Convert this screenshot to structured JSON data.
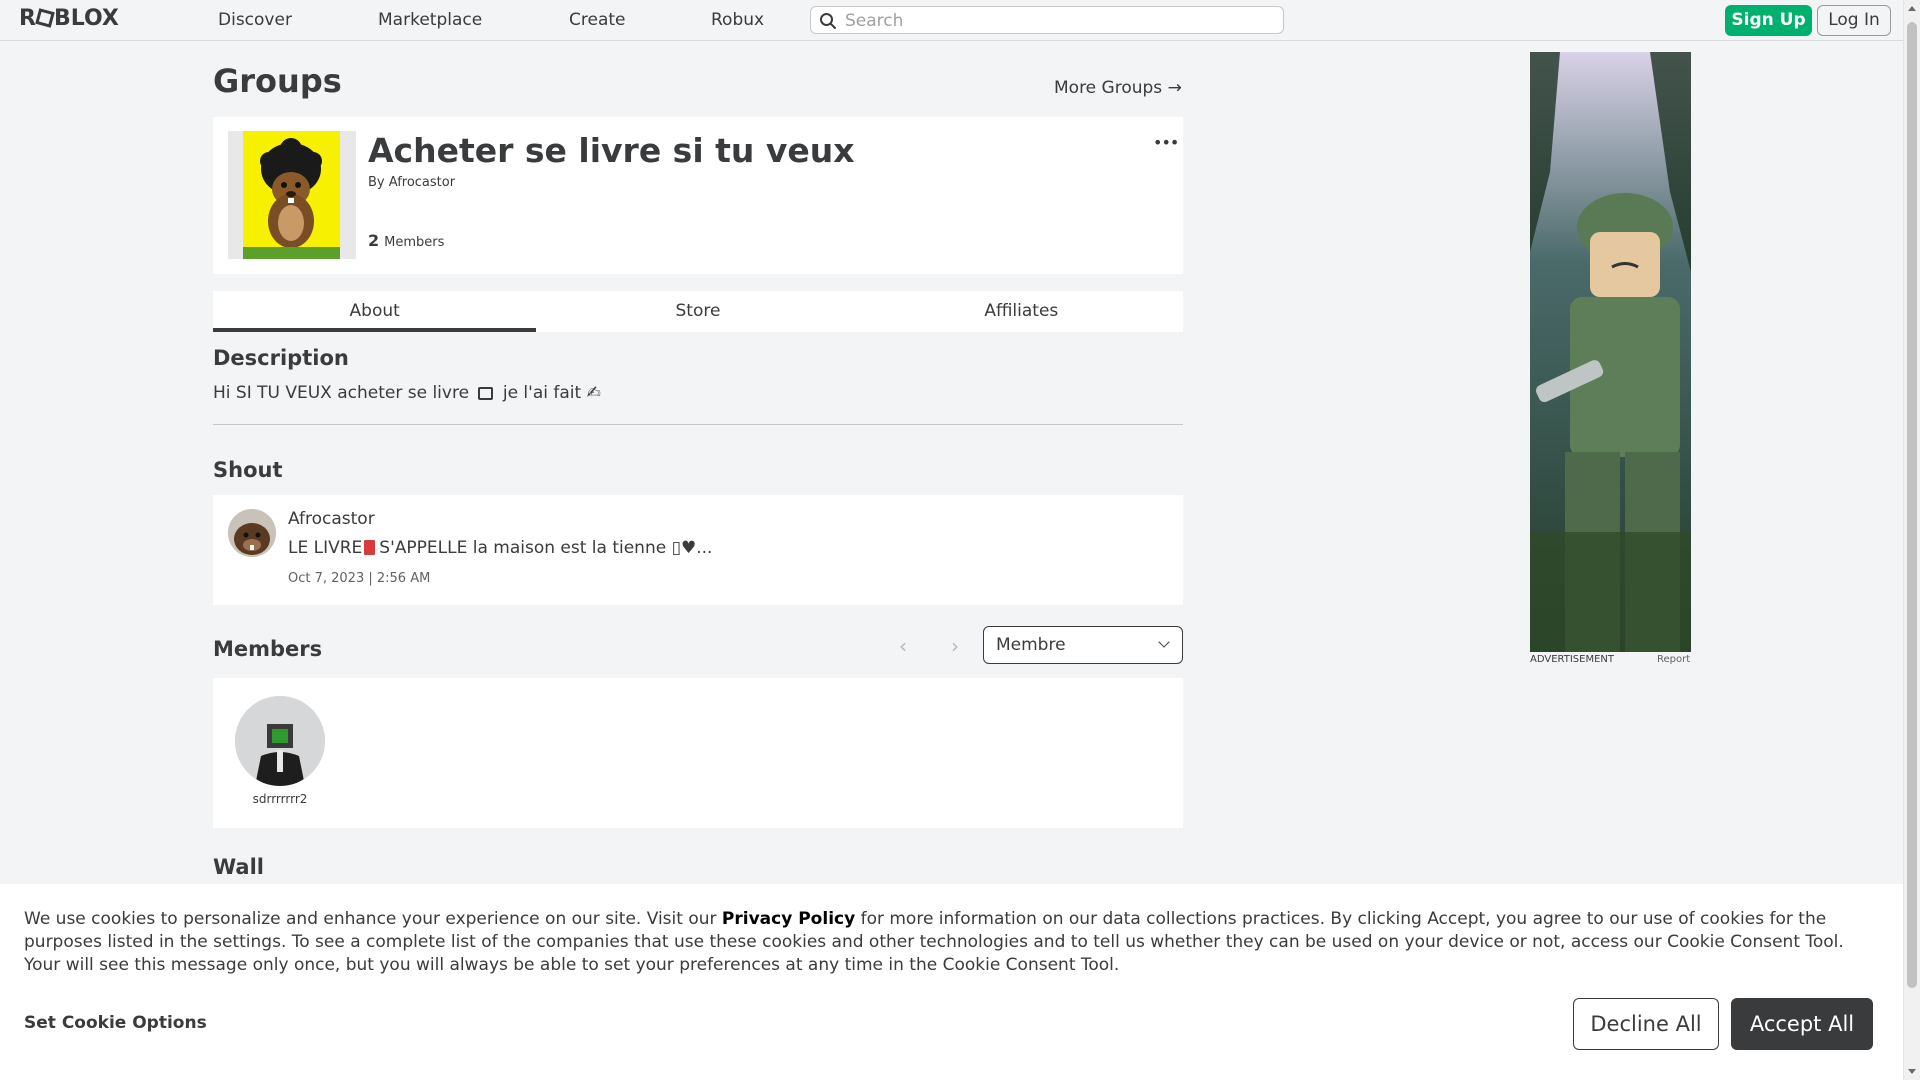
{
  "header": {
    "logo": "ROBLOX",
    "nav": [
      "Discover",
      "Marketplace",
      "Create",
      "Robux"
    ],
    "search_placeholder": "Search",
    "signup_label": "Sign Up",
    "login_label": "Log In"
  },
  "page": {
    "title": "Groups",
    "more_groups": "More Groups →"
  },
  "group": {
    "name": "Acheter se livre si tu veux",
    "by_prefix": "By",
    "owner": "Afrocastor",
    "member_count": "2",
    "members_label": "Members",
    "menu_glyph": "•••"
  },
  "tabs": [
    "About",
    "Store",
    "Affiliates"
  ],
  "description": {
    "title": "Description",
    "text_before": "Hi SI TU VEUX acheter se livre",
    "text_after": "je l'ai fait ✍"
  },
  "shout": {
    "title": "Shout",
    "poster": "Afrocastor",
    "body_before": "LE LIVRE",
    "body_after": "S'APPELLE la maison est la tienne ▯♥...",
    "date": "Oct 7, 2023 | 2:56 AM"
  },
  "members": {
    "title": "Members",
    "role_selected": "Membre",
    "prev_glyph": "‹",
    "next_glyph": "›",
    "list": [
      {
        "username": "sdrrrrrrr2"
      }
    ]
  },
  "wall": {
    "title": "Wall"
  },
  "ad": {
    "label": "ADVERTISEMENT",
    "report": "Report"
  },
  "cookie": {
    "text_before": "We use cookies to personalize and enhance your experience on our site. Visit our",
    "privacy_link": "Privacy Policy",
    "text_after": "for more information on our data collections practices. By clicking Accept, you agree to our use of cookies for the purposes listed in the settings. To see a complete list of the companies that use these cookies and other technologies and to tell us whether they can be used on your device or not, access our Cookie Consent Tool. Your will see this message only once, but you will always be able to set your preferences at any time in the Cookie Consent Tool.",
    "options_label": "Set Cookie Options",
    "decline_label": "Decline All",
    "accept_label": "Accept All"
  },
  "colors": {
    "signup_green": "#00b06f",
    "background": "#f2f4f5",
    "text": "#393b3d"
  },
  "icons": [
    "search-icon",
    "more-icon",
    "chevron-left-icon",
    "chevron-right-icon",
    "chevron-down-icon",
    "arrow-right-icon"
  ]
}
